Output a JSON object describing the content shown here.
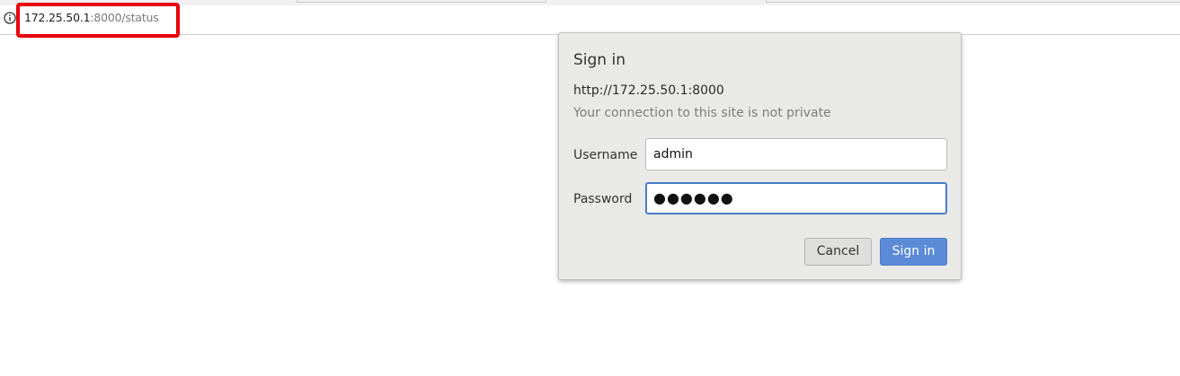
{
  "browser": {
    "address_bar": {
      "url_host": "172.25.50.1",
      "url_rest": ":8000/status",
      "info_icon": "info-icon"
    },
    "highlight_color": "#e8000a"
  },
  "dialog": {
    "title": "Sign in",
    "origin": "http://172.25.50.1:8000",
    "warning": "Your connection to this site is not private",
    "username_label": "Username",
    "username_value": "admin",
    "password_label": "Password",
    "password_masked": "●●●●●●",
    "cancel_label": "Cancel",
    "signin_label": "Sign in",
    "accent_color": "#5b8ad6"
  }
}
